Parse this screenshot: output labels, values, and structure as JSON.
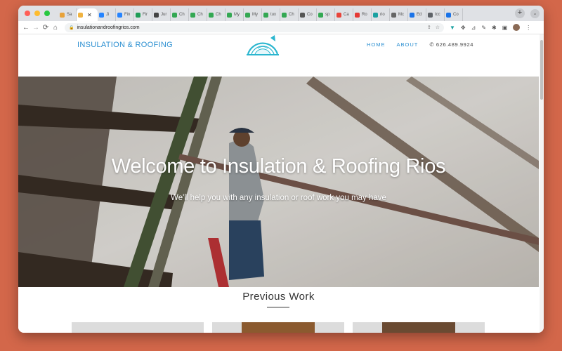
{
  "browser": {
    "tabs": [
      {
        "label": "Sa",
        "color": "#e8a23a"
      },
      {
        "label": "",
        "color": "#f0b341",
        "active": true
      },
      {
        "label": "Ji",
        "color": "#2684ff"
      },
      {
        "label": "Fin",
        "color": "#2684ff"
      },
      {
        "label": "Fir",
        "color": "#1f9d57"
      },
      {
        "label": "Jur",
        "color": "#444444"
      },
      {
        "label": "Ch",
        "color": "#34a853"
      },
      {
        "label": "Ch",
        "color": "#34a853"
      },
      {
        "label": "Ch",
        "color": "#34a853"
      },
      {
        "label": "My",
        "color": "#34a853"
      },
      {
        "label": "My",
        "color": "#34a853"
      },
      {
        "label": "tux",
        "color": "#34a853"
      },
      {
        "label": "Ch",
        "color": "#34a853"
      },
      {
        "label": "Co",
        "color": "#555555"
      },
      {
        "label": "sp",
        "color": "#34a853"
      },
      {
        "label": "Ca",
        "color": "#e8443a"
      },
      {
        "label": "Ro",
        "color": "#e53935"
      },
      {
        "label": "rio",
        "color": "#1aa1a1"
      },
      {
        "label": "Mc",
        "color": "#666666"
      },
      {
        "label": "Ed",
        "color": "#1a73e8"
      },
      {
        "label": "Icc",
        "color": "#5f6368"
      },
      {
        "label": "Co",
        "color": "#1a73e8"
      }
    ],
    "url": "insulationandroofingrios.com",
    "colors": {
      "close": "#ff5f57",
      "minimize": "#febc2e",
      "maximize": "#28c840"
    }
  },
  "site": {
    "brand": "INSULATION & ROOFING",
    "nav": {
      "home": "HOME",
      "about": "ABOUT",
      "phone": "626.489.9924"
    },
    "hero": {
      "title": "Welcome to Insulation & Roofing Rios",
      "subtitle": "We'll help you with any insulation or roof work you may have"
    },
    "section_title": "Previous Work",
    "accent": "#2b8fd1"
  }
}
